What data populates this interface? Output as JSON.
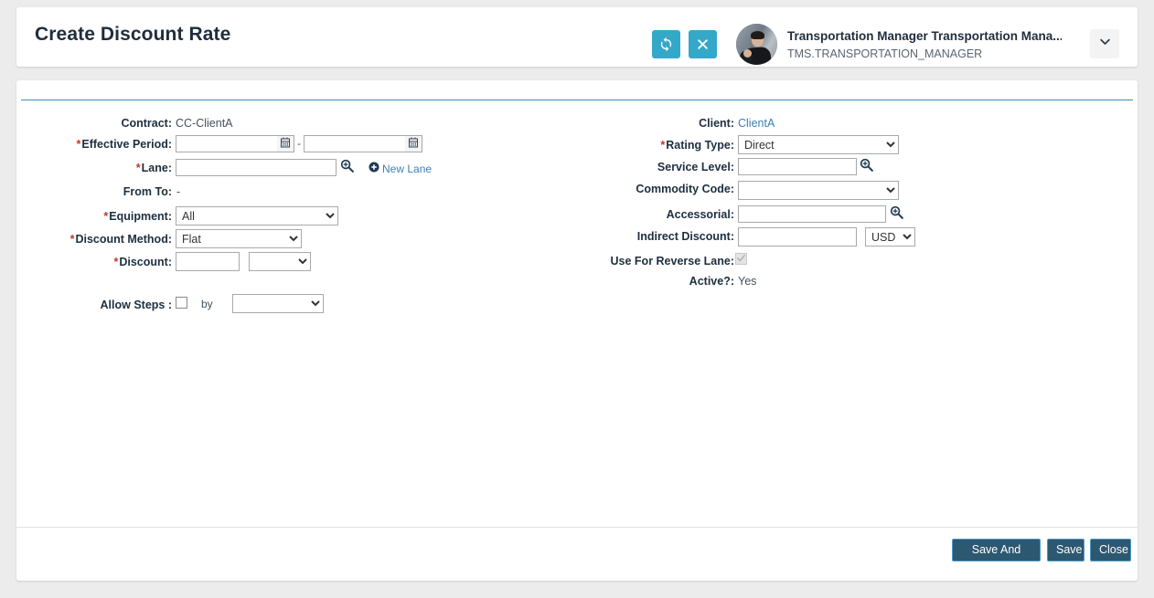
{
  "header": {
    "title": "Create Discount Rate",
    "refresh_icon": "refresh-icon",
    "close_icon": "close-icon",
    "user_name": "Transportation Manager Transportation Mana...",
    "user_login": "TMS.TRANSPORTATION_MANAGER",
    "caret_icon": "chevron-down-icon"
  },
  "colors": {
    "teal_button": "#34a8c8",
    "footer_button": "#2d5871",
    "footer_button_border": "#4a9bc4",
    "accent_rule": "#3d8eaf",
    "link": "#3e7fb5",
    "required_asterisk": "#c0392b",
    "page_background": "#ececec"
  },
  "form": {
    "left": {
      "contract": {
        "label": "Contract:",
        "value": "CC-ClientA",
        "required": false
      },
      "effective_period": {
        "label": "Effective Period:",
        "required": true,
        "from_value": "",
        "to_value": "",
        "separator": "-",
        "calendar_icon": "calendar-icon"
      },
      "lane": {
        "label": "Lane:",
        "required": true,
        "value": "",
        "search_icon": "search-icon",
        "new_lane_label": "New Lane",
        "new_lane_icon": "plus-circle-icon"
      },
      "from_to": {
        "label": "From To:",
        "value": "-",
        "required": false
      },
      "equipment": {
        "label": "Equipment:",
        "required": true,
        "value": "All"
      },
      "discount_method": {
        "label": "Discount Method:",
        "required": true,
        "value": "Flat"
      },
      "discount": {
        "label": "Discount:",
        "required": true,
        "value": "",
        "unit_value": ""
      },
      "allow_steps": {
        "label": "Allow Steps :",
        "checked": false,
        "by_label": "by",
        "by_value": ""
      }
    },
    "right": {
      "client": {
        "label": "Client:",
        "value": "ClientA",
        "required": false
      },
      "rating_type": {
        "label": "Rating Type:",
        "required": true,
        "value": "Direct"
      },
      "service_level": {
        "label": "Service Level:",
        "value": "",
        "required": false,
        "search_icon": "search-icon"
      },
      "commodity_code": {
        "label": "Commodity Code:",
        "value": "",
        "required": false
      },
      "accessorial": {
        "label": "Accessorial:",
        "value": "",
        "required": false,
        "search_icon": "search-icon"
      },
      "indirect_discount": {
        "label": "Indirect Discount:",
        "value": "",
        "currency": "USD",
        "required": false
      },
      "use_for_reverse_lane": {
        "label": "Use For Reverse Lane:",
        "checked": true,
        "disabled": true
      },
      "active": {
        "label": "Active?:",
        "value": "Yes",
        "required": false
      }
    }
  },
  "footer": {
    "save_and_copy_label": "Save And Copy",
    "save_label": "Save",
    "close_label": "Close"
  }
}
